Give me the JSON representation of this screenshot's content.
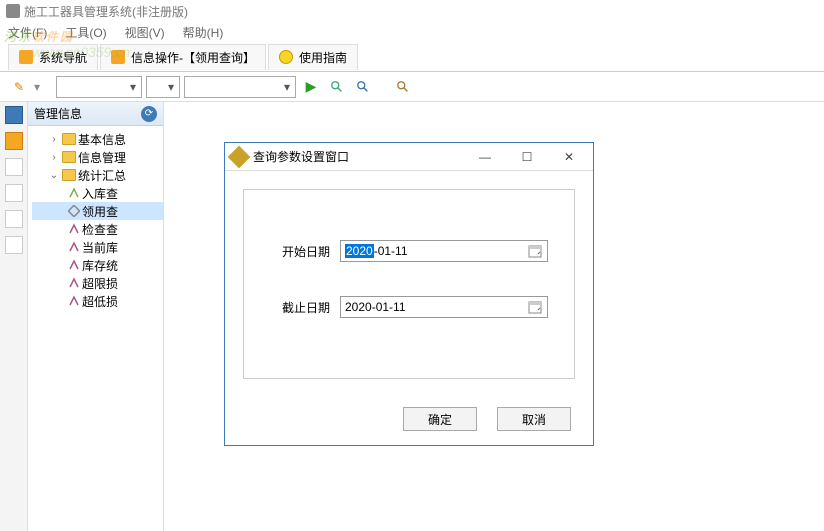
{
  "watermark": {
    "text_a": "河东",
    "text_b": "软件园",
    "sub": "www.pc0359.cn"
  },
  "window": {
    "title": "施工工器具管理系统(非注册版)"
  },
  "menu": {
    "file": "文件(F)",
    "tool": "工具(O)",
    "view": "视图(V)",
    "help": "帮助(H)"
  },
  "tabs": {
    "nav": "系统导航",
    "op": "信息操作-【领用查询】",
    "guide": "使用指南"
  },
  "toolbar": {
    "pencil": "✎"
  },
  "tree": {
    "header": "管理信息",
    "nodes": {
      "basic": "基本信息",
      "info": "信息管理",
      "stat": "统计汇总",
      "in": "入库查",
      "out": "领用查",
      "check": "检查查",
      "current": "当前库",
      "stock": "库存统",
      "over": "超限损",
      "under": "超低损"
    }
  },
  "dialog": {
    "title": "查询参数设置窗口",
    "start_label": "开始日期",
    "end_label": "截止日期",
    "start_year": "2020",
    "start_rest": "-01-11",
    "end_value": "2020-01-11",
    "ok": "确定",
    "cancel": "取消",
    "min": "—",
    "max": "☐",
    "close": "✕"
  }
}
